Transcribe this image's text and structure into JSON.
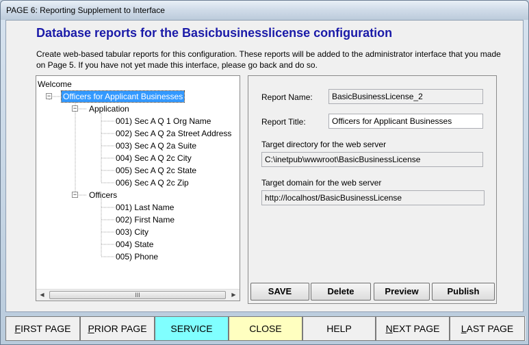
{
  "window": {
    "title": "PAGE 6: Reporting Supplement to Interface"
  },
  "header": {
    "title": "Database reports for the Basicbusinesslicense configuration",
    "description": "Create web-based tabular reports for this configuration. These reports will be added to the administrator interface that you made on Page 5. If you have not yet made this interface, please go back and do so."
  },
  "tree": {
    "root": "Welcome",
    "report": "Officers for Applicant Businesses",
    "group1": "Application",
    "group1_items": [
      "001) Sec A Q 1 Org Name",
      "002) Sec A Q 2a Street Address",
      "003) Sec A Q 2a Suite",
      "004) Sec A Q 2c City",
      "005) Sec A Q 2c State",
      "006) Sec A Q 2c Zip"
    ],
    "group2": "Officers",
    "group2_items": [
      "001) Last Name",
      "002) First Name",
      "003) City",
      "004) State",
      "005) Phone"
    ],
    "scroll_grip": "III"
  },
  "form": {
    "report_name_label": "Report Name:",
    "report_name_value": "BasicBusinessLicense_2",
    "report_title_label": "Report Title:",
    "report_title_value": "Officers for Applicant Businesses",
    "target_dir_label": "Target directory for the web server",
    "target_dir_value": "C:\\inetpub\\wwwroot\\BasicBusinessLicense",
    "target_domain_label": "Target domain for the web server",
    "target_domain_value": "http://localhost/BasicBusinessLicense",
    "buttons": {
      "save": "SAVE",
      "delete": "Delete",
      "preview": "Preview",
      "publish": "Publish"
    }
  },
  "nav": {
    "first_page": {
      "key": "F",
      "rest": "IRST PAGE"
    },
    "prior_page": {
      "key": "P",
      "rest": "RIOR PAGE"
    },
    "service": "SERVICE",
    "close": "CLOSE",
    "help": "HELP",
    "next_page": {
      "key": "N",
      "rest": "EXT PAGE"
    },
    "last_page": {
      "key": "L",
      "rest": "AST PAGE"
    }
  },
  "colors": {
    "heading": "#1a1aa8",
    "selection": "#3399ff",
    "service_bg": "#80ffff",
    "close_bg": "#ffffc0"
  }
}
